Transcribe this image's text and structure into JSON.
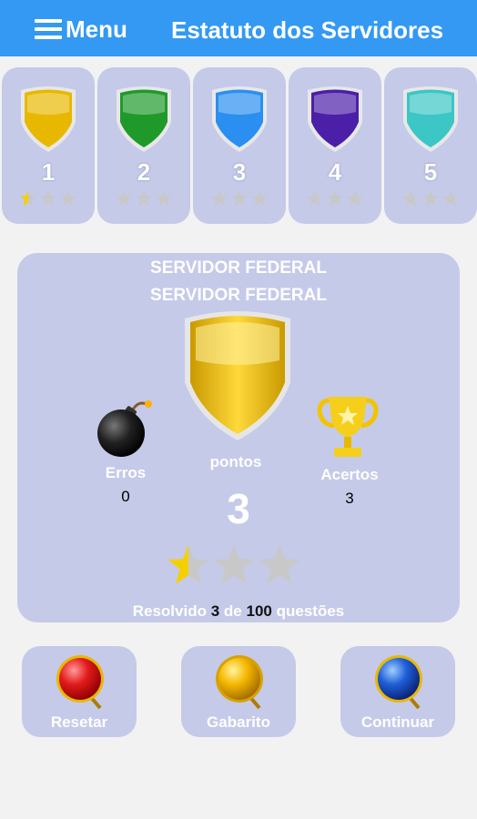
{
  "header": {
    "menu_label": "Menu",
    "title": "Estatuto dos Servidores",
    "background": "#3399f3"
  },
  "levels": [
    {
      "number": "1",
      "color": "#e8b800",
      "stars_filled": 0.5
    },
    {
      "number": "2",
      "color": "#1f9a2a",
      "stars_filled": 0
    },
    {
      "number": "3",
      "color": "#2a8ff0",
      "stars_filled": 0
    },
    {
      "number": "4",
      "color": "#4b1fa8",
      "stars_filled": 0
    },
    {
      "number": "5",
      "color": "#3cc6c6",
      "stars_filled": 0
    }
  ],
  "panel": {
    "title1": "SERVIDOR FEDERAL",
    "title2": "SERVIDOR FEDERAL",
    "errors_label": "Erros",
    "errors_value": "0",
    "points_label": "pontos",
    "points_value": "3",
    "hits_label": "Acertos",
    "hits_value": "3",
    "stars_filled": 0.5,
    "resolved_prefix": "Resolvido",
    "resolved_count": "3",
    "resolved_of": "de",
    "resolved_total": "100",
    "resolved_suffix": "questões"
  },
  "actions": {
    "reset_label": "Resetar",
    "answers_label": "Gabarito",
    "continue_label": "Continuar"
  },
  "colors": {
    "card_bg": "#c5cae9",
    "page_bg": "#f2f2f2",
    "star_gold": "#f5d000",
    "star_grey": "#c8c8c8"
  }
}
